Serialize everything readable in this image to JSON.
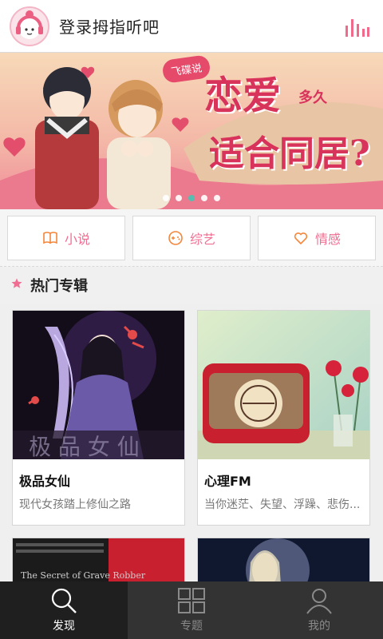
{
  "header": {
    "title": "登录拇指听吧",
    "avatar_icon": "headphone-girl-icon",
    "right_icon": "equalizer-bars-icon"
  },
  "banner": {
    "tag": "飞碟说",
    "title_line1": "恋爱",
    "title_small": "多久",
    "title_line2": "适合同居?",
    "dots_count": 5,
    "active_dot": 2
  },
  "categories": [
    {
      "label": "小说",
      "icon": "book-icon"
    },
    {
      "label": "综艺",
      "icon": "gamepad-icon"
    },
    {
      "label": "情感",
      "icon": "heart-icon"
    }
  ],
  "section": {
    "title": "热门专辑",
    "icon": "star-icon"
  },
  "albums": [
    {
      "title": "极品女仙",
      "description": "现代女孩踏上修仙之路"
    },
    {
      "title": "心理FM",
      "description": "当你迷茫、失望、浮躁、悲伤..."
    },
    {
      "title": "",
      "description": "",
      "image_text": "The Secret of Grave Robber"
    },
    {
      "title": "",
      "description": ""
    }
  ],
  "tabs": [
    {
      "label": "发现",
      "icon": "search-icon",
      "active": true
    },
    {
      "label": "专题",
      "icon": "grid-icon",
      "active": false
    },
    {
      "label": "我的",
      "icon": "user-icon",
      "active": false
    }
  ],
  "colors": {
    "accent": "#f06e92",
    "tabbar": "#333333",
    "active_dot": "#46c4b4"
  }
}
